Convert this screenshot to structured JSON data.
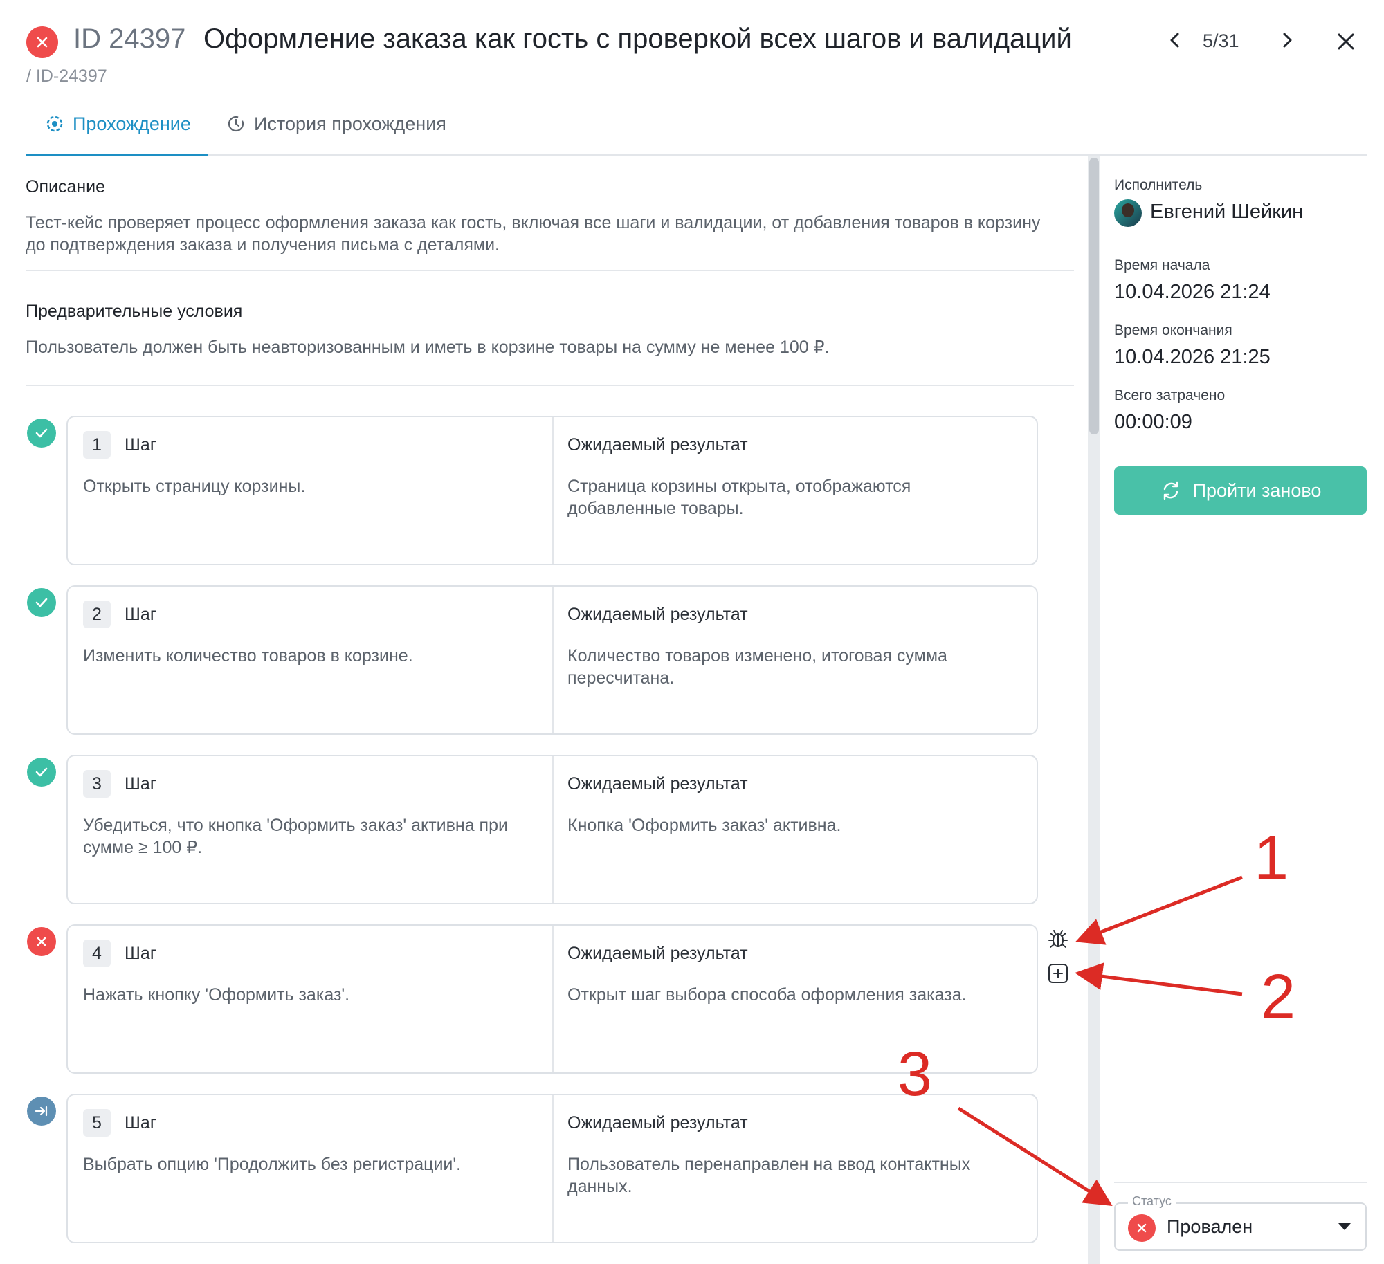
{
  "header": {
    "id_label": "ID 24397",
    "title": "Оформление заказа как гость с проверкой всех шагов и валидаций",
    "breadcrumb": "/ ID-24397",
    "counter": "5/31"
  },
  "tabs": [
    {
      "label": "Прохождение",
      "active": true
    },
    {
      "label": "История прохождения",
      "active": false
    }
  ],
  "description": {
    "title": "Описание",
    "text": "Тест-кейс проверяет процесс оформления заказа как гость, включая все шаги и валидации, от добавления товаров в корзину до подтверждения заказа и получения письма с деталями."
  },
  "preconditions": {
    "title": "Предварительные условия",
    "text": "Пользователь должен быть неавторизованным и иметь в корзине товары на сумму не менее 100 ₽."
  },
  "steps": [
    {
      "num": "1",
      "label": "Шаг",
      "action": "Открыть страницу корзины.",
      "expected_label": "Ожидаемый результат",
      "expected": "Страница корзины открыта, отображаются добавленные товары.",
      "status": "passed"
    },
    {
      "num": "2",
      "label": "Шаг",
      "action": "Изменить количество товаров в корзине.",
      "expected_label": "Ожидаемый результат",
      "expected": "Количество товаров изменено, итоговая сумма пересчитана.",
      "status": "passed"
    },
    {
      "num": "3",
      "label": "Шаг",
      "action": "Убедиться, что кнопка 'Оформить заказ' активна при сумме ≥ 100 ₽.",
      "expected_label": "Ожидаемый результат",
      "expected": "Кнопка 'Оформить заказ' активна.",
      "status": "passed"
    },
    {
      "num": "4",
      "label": "Шаг",
      "action": "Нажать кнопку 'Оформить заказ'.",
      "expected_label": "Ожидаемый результат",
      "expected": "Открыт шаг выбора способа оформления заказа.",
      "status": "failed"
    },
    {
      "num": "5",
      "label": "Шаг",
      "action": "Выбрать опцию 'Продолжить без регистрации'.",
      "expected_label": "Ожидаемый результат",
      "expected": "Пользователь перенаправлен на ввод контактных данных.",
      "status": "skipped"
    }
  ],
  "side": {
    "executor_label": "Исполнитель",
    "executor_name": "Евгений Шейкин",
    "start_label": "Время начала",
    "start_value": "10.04.2026 21:24",
    "end_label": "Время окончания",
    "end_value": "10.04.2026 21:25",
    "total_label": "Всего затрачено",
    "total_value": "00:00:09",
    "retry_label": "Пройти заново",
    "status_legend": "Статус",
    "status_value": "Провален"
  },
  "annotations": [
    "1",
    "2",
    "3"
  ],
  "colors": {
    "accent": "#1d8fc4",
    "passed": "#3cbfa5",
    "failed": "#ef4b4b",
    "skipped": "#5e8fb3",
    "button": "#49c1a8",
    "annotation": "#dc2b25"
  },
  "icons": {
    "fail": "close-icon",
    "pass": "check-icon",
    "skip": "skip-arrow-icon",
    "bug": "bug-icon",
    "add": "plus-square-icon",
    "retry": "refresh-icon"
  }
}
